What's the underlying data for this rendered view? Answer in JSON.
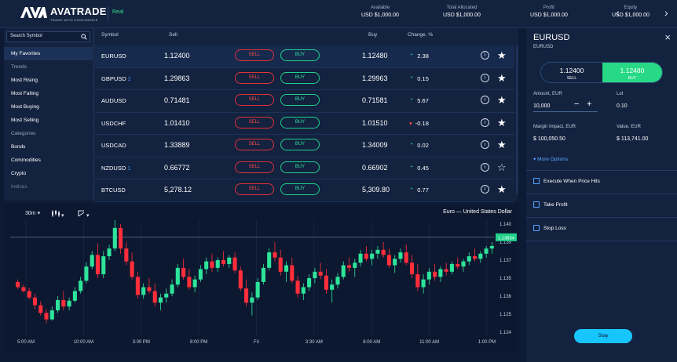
{
  "header": {
    "brand": "AVATRADE",
    "tagline": "TRADE WITH CONFIDENCE",
    "mode": "Real",
    "stats": [
      {
        "label": "Available",
        "value": "USD $1,000.00"
      },
      {
        "label": "Total Allocated",
        "value": "USD $1,000.00"
      },
      {
        "label": "Profit",
        "value": "USD $1,000.00"
      },
      {
        "label": "Equity",
        "value": "USD $1,000.00"
      }
    ],
    "nav_prev": "‹",
    "nav_next": "›"
  },
  "sidebar": {
    "search_placeholder": "Search Symbol",
    "favorites": "My Favorites",
    "trends_heading": "Trends",
    "trends": [
      "Most Rising",
      "Most Falling",
      "Most Buying",
      "Most Selling"
    ],
    "categories_heading": "Categories",
    "categories": [
      "Bonds",
      "Commodities",
      "Crypto",
      "Indices"
    ]
  },
  "table": {
    "headers": {
      "symbol": "Symbol",
      "sell": "Sell",
      "buy": "Buy",
      "change": "Change, %"
    },
    "sell_label": "SELL",
    "buy_label": "BUY",
    "rows": [
      {
        "symbol": "EURUSD",
        "mark": "",
        "sell": "1.12400",
        "buy": "1.12480",
        "change": "2.38",
        "dir": "up",
        "fav": true
      },
      {
        "symbol": "GBPUSD",
        "mark": "2",
        "sell": "1.29863",
        "buy": "1.29963",
        "change": "0.15",
        "dir": "up",
        "fav": true
      },
      {
        "symbol": "AUDUSD",
        "mark": "",
        "sell": "0.71481",
        "buy": "0.71581",
        "change": "5.67",
        "dir": "up",
        "fav": true
      },
      {
        "symbol": "USDCHF",
        "mark": "",
        "sell": "1.01410",
        "buy": "1.01510",
        "change": "-0.18",
        "dir": "down",
        "fav": true
      },
      {
        "symbol": "USDCAD",
        "mark": "",
        "sell": "1.33889",
        "buy": "1.34009",
        "change": "0.02",
        "dir": "up",
        "fav": true
      },
      {
        "symbol": "NZDUSD",
        "mark": "1",
        "sell": "0.66772",
        "buy": "0.66902",
        "change": "0.45",
        "dir": "up",
        "fav": false
      },
      {
        "symbol": "BTCUSD",
        "mark": "",
        "sell": "5,278.12",
        "buy": "5,309.80",
        "change": "0.77",
        "dir": "up",
        "fav": true
      }
    ]
  },
  "chart": {
    "timeframe": "30m",
    "chart_type": "candle",
    "draw_tool": "draw",
    "title": "Euro — United States Dollar",
    "current_price": "1.13834"
  },
  "chart_data": {
    "type": "candlestick",
    "title": "Euro — United States Dollar",
    "x_ticks": [
      "5:00 AM",
      "10:00 AM",
      "3:00 PM",
      "8:00 PM",
      "Fri",
      "3:30 AM",
      "8:00 AM",
      "11:00 AM",
      "1:00 PM"
    ],
    "y_ticks": [
      "1.140",
      "1.139",
      "1.137",
      "1.135",
      "1.136",
      "1.125",
      "1.124"
    ],
    "ylim": [
      1.123,
      1.141
    ],
    "current_price": 1.13834,
    "up_color": "#2de49a",
    "down_color": "#ff2e3a",
    "candles": [
      [
        1.1314,
        1.1318,
        1.1303,
        1.1306
      ],
      [
        1.1306,
        1.131,
        1.1298,
        1.13
      ],
      [
        1.13,
        1.1305,
        1.1287,
        1.129
      ],
      [
        1.129,
        1.1296,
        1.1272,
        1.1278
      ],
      [
        1.1278,
        1.1284,
        1.1262,
        1.1266
      ],
      [
        1.1266,
        1.1272,
        1.125,
        1.1256
      ],
      [
        1.1256,
        1.1276,
        1.1254,
        1.127
      ],
      [
        1.127,
        1.1292,
        1.1266,
        1.1286
      ],
      [
        1.1286,
        1.13,
        1.127,
        1.1276
      ],
      [
        1.1276,
        1.129,
        1.127,
        1.1285
      ],
      [
        1.1285,
        1.1306,
        1.1282,
        1.13
      ],
      [
        1.13,
        1.1322,
        1.1296,
        1.1316
      ],
      [
        1.1316,
        1.1345,
        1.1312,
        1.1338
      ],
      [
        1.1338,
        1.1362,
        1.1334,
        1.1356
      ],
      [
        1.1356,
        1.1374,
        1.132,
        1.1326
      ],
      [
        1.1326,
        1.1362,
        1.132,
        1.1354
      ],
      [
        1.1354,
        1.1372,
        1.1348,
        1.1366
      ],
      [
        1.1366,
        1.141,
        1.1362,
        1.1398
      ],
      [
        1.1398,
        1.1404,
        1.1358,
        1.1366
      ],
      [
        1.1366,
        1.1376,
        1.134,
        1.1346
      ],
      [
        1.1346,
        1.136,
        1.1318,
        1.1322
      ],
      [
        1.1322,
        1.133,
        1.1288,
        1.1294
      ],
      [
        1.1294,
        1.1312,
        1.1288,
        1.1306
      ],
      [
        1.1306,
        1.132,
        1.1296,
        1.13
      ],
      [
        1.13,
        1.1312,
        1.1276,
        1.1282
      ],
      [
        1.1282,
        1.1296,
        1.127,
        1.129
      ],
      [
        1.129,
        1.1304,
        1.1282,
        1.1296
      ],
      [
        1.1296,
        1.1318,
        1.1292,
        1.131
      ],
      [
        1.131,
        1.1342,
        1.1306,
        1.1336
      ],
      [
        1.1336,
        1.135,
        1.1318,
        1.1322
      ],
      [
        1.1322,
        1.1334,
        1.1302,
        1.1306
      ],
      [
        1.1306,
        1.1324,
        1.1298,
        1.1318
      ],
      [
        1.1318,
        1.134,
        1.1314,
        1.1334
      ],
      [
        1.1334,
        1.1352,
        1.1326,
        1.1346
      ],
      [
        1.1346,
        1.1358,
        1.133,
        1.1336
      ],
      [
        1.1336,
        1.1352,
        1.133,
        1.1348
      ],
      [
        1.1348,
        1.1362,
        1.1338,
        1.1342
      ],
      [
        1.1342,
        1.1356,
        1.1336,
        1.1352
      ],
      [
        1.1352,
        1.136,
        1.1328,
        1.1332
      ],
      [
        1.1332,
        1.1338,
        1.13,
        1.1304
      ],
      [
        1.1304,
        1.1318,
        1.1276,
        1.1282
      ],
      [
        1.1282,
        1.1298,
        1.1262,
        1.129
      ],
      [
        1.129,
        1.132,
        1.1286,
        1.1314
      ],
      [
        1.1314,
        1.1342,
        1.131,
        1.1336
      ],
      [
        1.1336,
        1.1366,
        1.1332,
        1.136
      ],
      [
        1.136,
        1.1376,
        1.1346,
        1.1352
      ],
      [
        1.1352,
        1.1364,
        1.1324,
        1.133
      ],
      [
        1.133,
        1.1346,
        1.1314,
        1.134
      ],
      [
        1.134,
        1.1352,
        1.1312,
        1.1316
      ],
      [
        1.1316,
        1.1324,
        1.129,
        1.1296
      ],
      [
        1.1296,
        1.1312,
        1.1286,
        1.1306
      ],
      [
        1.1306,
        1.1326,
        1.13,
        1.132
      ],
      [
        1.132,
        1.1336,
        1.1312,
        1.133
      ],
      [
        1.133,
        1.1344,
        1.1318,
        1.1324
      ],
      [
        1.1324,
        1.1334,
        1.1296,
        1.1302
      ],
      [
        1.1302,
        1.1318,
        1.1282,
        1.131
      ],
      [
        1.131,
        1.1328,
        1.1304,
        1.1322
      ],
      [
        1.1322,
        1.1346,
        1.1318,
        1.134
      ],
      [
        1.134,
        1.1352,
        1.133,
        1.1336
      ],
      [
        1.1336,
        1.135,
        1.1322,
        1.1344
      ],
      [
        1.1344,
        1.1364,
        1.1338,
        1.1358
      ],
      [
        1.1358,
        1.137,
        1.1346,
        1.135
      ],
      [
        1.135,
        1.1364,
        1.134,
        1.1358
      ],
      [
        1.1358,
        1.137,
        1.135,
        1.1364
      ],
      [
        1.1364,
        1.1376,
        1.1352,
        1.1356
      ],
      [
        1.1356,
        1.1366,
        1.1336,
        1.134
      ],
      [
        1.134,
        1.1356,
        1.1328,
        1.135
      ],
      [
        1.135,
        1.1366,
        1.1344,
        1.136
      ],
      [
        1.136,
        1.1372,
        1.134,
        1.1344
      ],
      [
        1.1344,
        1.1356,
        1.132,
        1.1326
      ],
      [
        1.1326,
        1.1342,
        1.13,
        1.1306
      ],
      [
        1.1306,
        1.1326,
        1.1296,
        1.1318
      ],
      [
        1.1318,
        1.1336,
        1.131,
        1.133
      ],
      [
        1.133,
        1.1342,
        1.1316,
        1.1322
      ],
      [
        1.1322,
        1.1338,
        1.1314,
        1.1334
      ],
      [
        1.1334,
        1.1344,
        1.1324,
        1.133
      ],
      [
        1.133,
        1.1346,
        1.1326,
        1.1342
      ],
      [
        1.1342,
        1.1352,
        1.1334,
        1.1338
      ],
      [
        1.1338,
        1.135,
        1.133,
        1.1346
      ],
      [
        1.1346,
        1.136,
        1.134,
        1.1354
      ],
      [
        1.1354,
        1.1366,
        1.1346,
        1.135
      ],
      [
        1.135,
        1.1362,
        1.1344,
        1.1358
      ],
      [
        1.1358,
        1.137,
        1.1352,
        1.1366
      ],
      [
        1.1366,
        1.1376,
        1.1358,
        1.137
      ]
    ]
  },
  "order": {
    "title": "EURUSD",
    "subtitle": "EURUSD",
    "close": "×",
    "sell_price": "1.12400",
    "sell_label": "SELL",
    "buy_price": "1.12480",
    "buy_label": "BUY",
    "amount_label": "Amount, EUR",
    "amount_value": "10,000",
    "lot_label": "Lot",
    "lot_value": "0.10",
    "margin_label": "Margin Impact, EUR",
    "margin_value": "$ 100,050.50",
    "value_label": "Value, EUR",
    "value_value": "$ 113,741.00",
    "more_options": "▾ More Options",
    "checks": [
      "Execute When Price Hits",
      "Take Profit",
      "Stop Loss"
    ],
    "stay_label": "Stay"
  }
}
